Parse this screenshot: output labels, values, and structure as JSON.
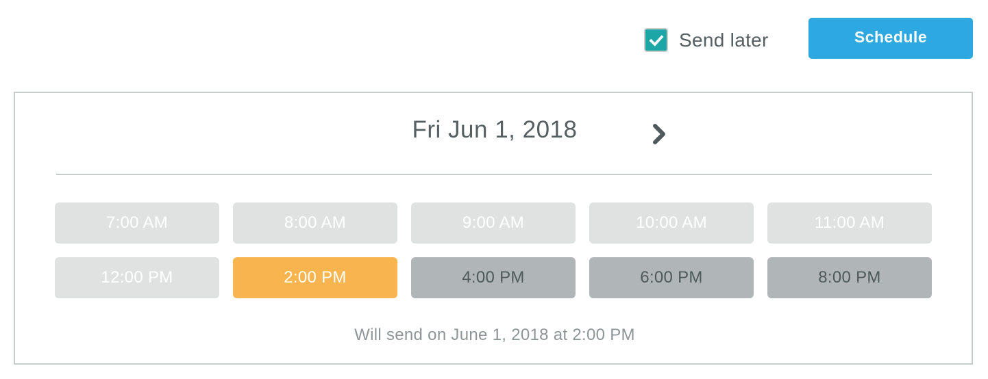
{
  "toolbar": {
    "send_later": {
      "label": "Send later",
      "checked": true,
      "icon": "checkmark-icon",
      "color": "#1ca6a6"
    },
    "schedule_button": {
      "label": "Schedule",
      "color": "#2ea8e0"
    }
  },
  "scheduler": {
    "date_title": "Fri Jun 1, 2018",
    "next_icon": "chevron-right-icon",
    "time_slots": [
      {
        "label": "7:00 AM",
        "state": "past"
      },
      {
        "label": "8:00 AM",
        "state": "past"
      },
      {
        "label": "9:00 AM",
        "state": "past"
      },
      {
        "label": "10:00 AM",
        "state": "past"
      },
      {
        "label": "11:00 AM",
        "state": "past"
      },
      {
        "label": "12:00 PM",
        "state": "past"
      },
      {
        "label": "2:00 PM",
        "state": "selected"
      },
      {
        "label": "4:00 PM",
        "state": "available"
      },
      {
        "label": "6:00 PM",
        "state": "available"
      },
      {
        "label": "8:00 PM",
        "state": "available"
      }
    ],
    "summary": "Will send on June 1, 2018 at 2:00 PM",
    "colors": {
      "past": "#e0e2e1",
      "selected": "#f8b54f",
      "available": "#b0b5b7"
    }
  }
}
